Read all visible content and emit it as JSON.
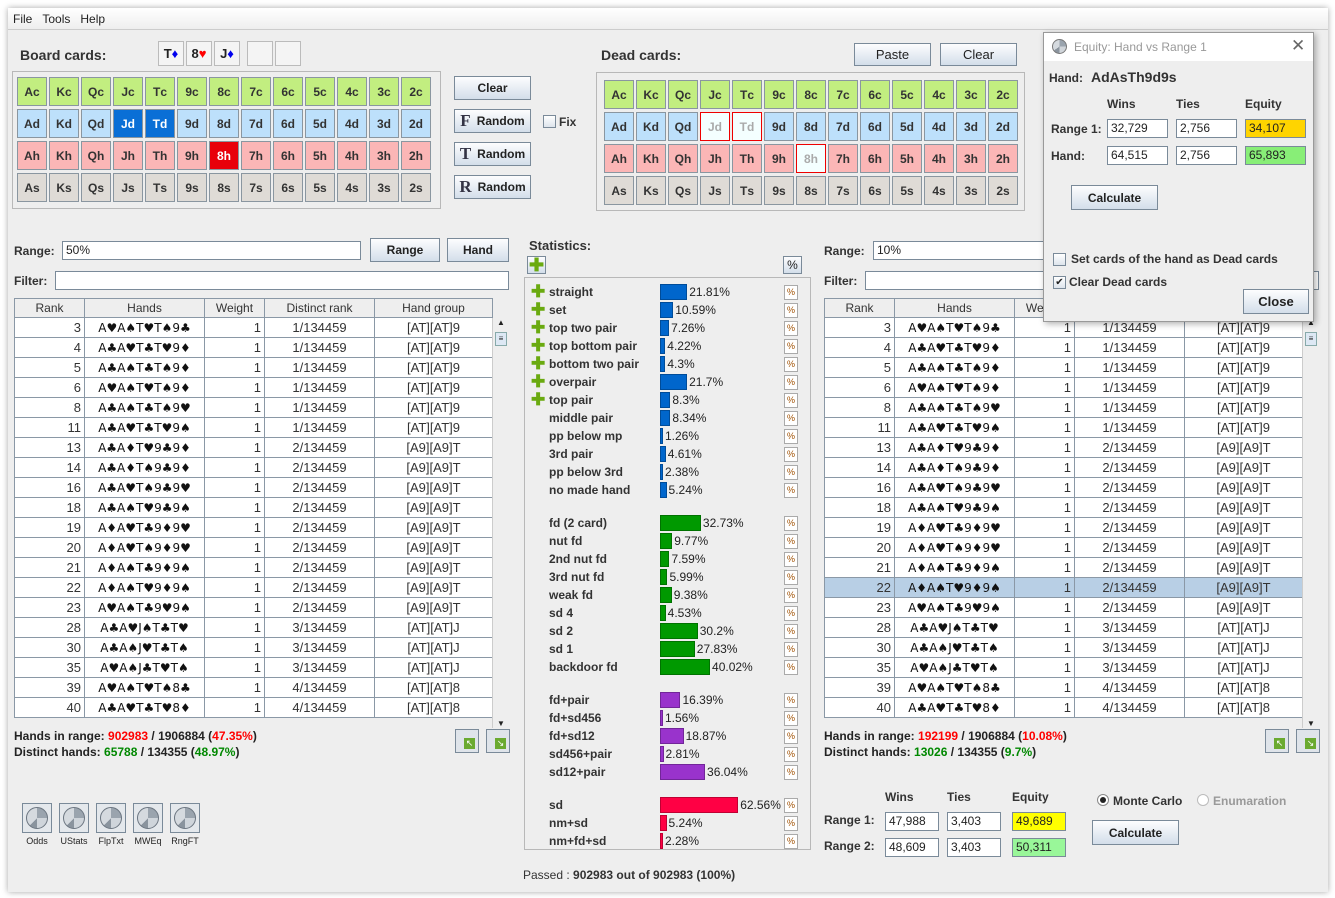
{
  "menu": [
    "File",
    "Tools",
    "Help"
  ],
  "board": {
    "label": "Board cards:",
    "slots": [
      {
        "rank": "T",
        "suit": "♦"
      },
      {
        "rank": "8",
        "suit": "♥"
      },
      {
        "rank": "J",
        "suit": "♦"
      },
      {
        "rank": "",
        "suit": ""
      },
      {
        "rank": "",
        "suit": ""
      }
    ],
    "selected": [
      "Jd",
      "Td",
      "8h"
    ],
    "buttons": {
      "clear": "Clear",
      "flop_random": "Random",
      "turn_random": "Random",
      "river_random": "Random",
      "fix": "Fix"
    }
  },
  "dead": {
    "label": "Dead cards:",
    "paste": "Paste",
    "clear": "Clear",
    "disabled": [
      "Jd",
      "Td",
      "8h"
    ]
  },
  "ranks": [
    "A",
    "K",
    "Q",
    "J",
    "T",
    "9",
    "8",
    "7",
    "6",
    "5",
    "4",
    "3",
    "2"
  ],
  "suits": [
    "c",
    "d",
    "h",
    "s"
  ],
  "left": {
    "range_label": "Range:",
    "range_value": "50%",
    "range_btn": "Range",
    "hand_btn": "Hand",
    "filter_label": "Filter:",
    "filter_value": "",
    "hands_in_range_label": "Hands in range:",
    "hir": "902983",
    "hir_total": " / 1906884 (",
    "hir_pct": "47.35%",
    "distinct_label": "Distinct hands:",
    "dh": "65788",
    "dh_total": " / 134355 (",
    "dh_pct": "48.97%"
  },
  "right": {
    "range_label": "Range:",
    "range_value": "10%",
    "filter_label": "Filter:",
    "filter_value": "",
    "hands_in_range_label": "Hands in range:",
    "hir": "192199",
    "hir_total": " / 1906884 (",
    "hir_pct": "10.08%",
    "distinct_label": "Distinct hands:",
    "dh": "13026",
    "dh_total": " / 134355 (",
    "dh_pct": "9.7%",
    "selected_rank": "22"
  },
  "table": {
    "columns": [
      "Rank",
      "Hands",
      "Weight",
      "Distinct rank",
      "Hand group"
    ],
    "rows": [
      [
        "3",
        "A♥A♠T♥T♠9♣",
        "1",
        "1/134459",
        "[AT][AT]9"
      ],
      [
        "4",
        "A♣A♥T♣T♥9♦",
        "1",
        "1/134459",
        "[AT][AT]9"
      ],
      [
        "5",
        "A♣A♠T♣T♠9♦",
        "1",
        "1/134459",
        "[AT][AT]9"
      ],
      [
        "6",
        "A♥A♠T♥T♠9♦",
        "1",
        "1/134459",
        "[AT][AT]9"
      ],
      [
        "8",
        "A♣A♠T♣T♠9♥",
        "1",
        "1/134459",
        "[AT][AT]9"
      ],
      [
        "11",
        "A♣A♥T♣T♥9♠",
        "1",
        "1/134459",
        "[AT][AT]9"
      ],
      [
        "13",
        "A♣A♦T♥9♣9♦",
        "1",
        "2/134459",
        "[A9][A9]T"
      ],
      [
        "14",
        "A♣A♦T♠9♣9♦",
        "1",
        "2/134459",
        "[A9][A9]T"
      ],
      [
        "16",
        "A♣A♥T♠9♣9♥",
        "1",
        "2/134459",
        "[A9][A9]T"
      ],
      [
        "18",
        "A♣A♠T♥9♣9♠",
        "1",
        "2/134459",
        "[A9][A9]T"
      ],
      [
        "19",
        "A♦A♥T♣9♦9♥",
        "1",
        "2/134459",
        "[A9][A9]T"
      ],
      [
        "20",
        "A♦A♥T♠9♦9♥",
        "1",
        "2/134459",
        "[A9][A9]T"
      ],
      [
        "21",
        "A♦A♠T♣9♦9♠",
        "1",
        "2/134459",
        "[A9][A9]T"
      ],
      [
        "22",
        "A♦A♠T♥9♦9♠",
        "1",
        "2/134459",
        "[A9][A9]T"
      ],
      [
        "23",
        "A♥A♠T♣9♥9♠",
        "1",
        "2/134459",
        "[A9][A9]T"
      ],
      [
        "28",
        "A♣A♥J♠T♣T♥",
        "1",
        "3/134459",
        "[AT][AT]J"
      ],
      [
        "30",
        "A♣A♠J♥T♣T♠",
        "1",
        "3/134459",
        "[AT][AT]J"
      ],
      [
        "35",
        "A♥A♠J♣T♥T♠",
        "1",
        "3/134459",
        "[AT][AT]J"
      ],
      [
        "39",
        "A♥A♠T♥T♠8♣",
        "1",
        "4/134459",
        "[AT][AT]8"
      ],
      [
        "40",
        "A♣A♥T♣T♥8♦",
        "1",
        "4/134459",
        "[AT][AT]8"
      ]
    ]
  },
  "suit_colors": {
    "♥": "#ff0000",
    "♦": "#0000ee",
    "♣": "#008800",
    "♠": "#000000"
  },
  "stats": {
    "label": "Statistics:",
    "pct_btn": "%",
    "groups": [
      {
        "color": "#0066cc",
        "items": [
          [
            "straight",
            21.81,
            true
          ],
          [
            "set",
            10.59,
            true
          ],
          [
            "top two pair",
            7.26,
            true
          ],
          [
            "top bottom pair",
            4.22,
            true
          ],
          [
            "bottom two pair",
            4.3,
            true
          ],
          [
            "overpair",
            21.7,
            true
          ],
          [
            "top pair",
            8.3,
            true
          ],
          [
            "middle pair",
            8.34,
            false
          ],
          [
            "pp below mp",
            1.26,
            false
          ],
          [
            "3rd pair",
            4.61,
            false
          ],
          [
            "pp below 3rd",
            2.38,
            false
          ],
          [
            "no made hand",
            5.24,
            false
          ]
        ]
      },
      {
        "color": "#009900",
        "items": [
          [
            "fd (2 card)",
            32.73,
            false
          ],
          [
            "nut fd",
            9.77,
            false
          ],
          [
            "2nd nut fd",
            7.59,
            false
          ],
          [
            "3rd nut fd",
            5.99,
            false
          ],
          [
            "weak fd",
            9.38,
            false
          ],
          [
            "sd 4",
            4.53,
            false
          ],
          [
            "sd 2",
            30.2,
            false
          ],
          [
            "sd 1",
            27.83,
            false
          ],
          [
            "backdoor fd",
            40.02,
            false
          ]
        ]
      },
      {
        "color": "#9933cc",
        "items": [
          [
            "fd+pair",
            16.39,
            false
          ],
          [
            "fd+sd456",
            1.56,
            false
          ],
          [
            "fd+sd12",
            18.87,
            false
          ],
          [
            "sd456+pair",
            2.81,
            false
          ],
          [
            "sd12+pair",
            36.04,
            false
          ]
        ]
      },
      {
        "color": "#ff0044",
        "items": [
          [
            "sd",
            62.56,
            false
          ],
          [
            "nm+sd",
            5.24,
            false
          ],
          [
            "nm+fd+sd",
            2.28,
            false
          ]
        ]
      }
    ]
  },
  "passed": {
    "prefix": "Passed : ",
    "value": "902983 out of 902983 (100%)"
  },
  "tools": [
    "Odds",
    "UStats",
    "FlpTxt",
    "MWEq",
    "RngFT"
  ],
  "equity": {
    "wins": "Wins",
    "ties": "Ties",
    "equity": "Equity",
    "r1_label": "Range 1:",
    "r2_label": "Range 2:",
    "r1": [
      "47,988",
      "3,403",
      "49,689"
    ],
    "r2": [
      "48,609",
      "3,403",
      "50,311"
    ],
    "monte_carlo": "Monte Carlo",
    "enumeration": "Enumaration",
    "mode": "Monte Carlo",
    "calculate": "Calculate",
    "r1_color": "#ffff00",
    "r2_color": "#99f799"
  },
  "dialog": {
    "title": "Equity: Hand vs Range 1",
    "hand_label": "Hand:",
    "hand": "AdAsTh9d9s",
    "wins": "Wins",
    "ties": "Ties",
    "equity": "Equity",
    "r1_label": "Range 1:",
    "hand_row_label": "Hand:",
    "r1": [
      "32,729",
      "2,756",
      "34,107"
    ],
    "hand_row": [
      "64,515",
      "2,756",
      "65,893"
    ],
    "calculate": "Calculate",
    "set_dead": "Set cards of the hand as Dead cards",
    "set_dead_checked": false,
    "clear_dead": "Clear Dead cards",
    "clear_dead_checked": true,
    "close": "Close",
    "r1_color": "#ffd400",
    "hand_color": "#88ee77"
  }
}
